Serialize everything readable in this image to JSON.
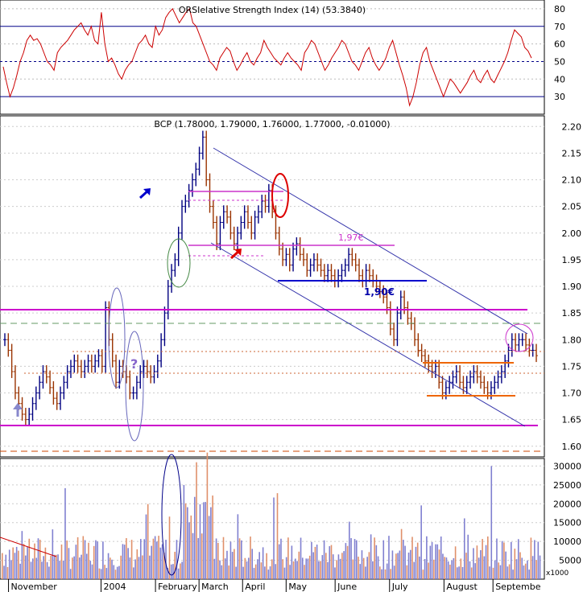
{
  "rsi_panel": {
    "title": "ORSIelative Strength Index (14) (53.3840)",
    "ylim": [
      20,
      85
    ],
    "ticks": [
      "80",
      "70",
      "60",
      "50",
      "40",
      "30"
    ],
    "tick_values": [
      80,
      70,
      60,
      50,
      40,
      30
    ],
    "line_color": "#cc0000",
    "upper_level": 70,
    "lower_level": 30,
    "mid_level": 50,
    "values": [
      47,
      38,
      30,
      35,
      42,
      50,
      55,
      62,
      65,
      62,
      63,
      60,
      55,
      50,
      48,
      45,
      55,
      58,
      60,
      62,
      65,
      68,
      70,
      72,
      68,
      65,
      70,
      62,
      60,
      78,
      60,
      50,
      52,
      48,
      43,
      40,
      45,
      48,
      50,
      55,
      60,
      62,
      65,
      60,
      58,
      70,
      65,
      68,
      75,
      78,
      80,
      76,
      72,
      75,
      78,
      80,
      72,
      70,
      65,
      60,
      55,
      50,
      48,
      45,
      52,
      55,
      58,
      56,
      50,
      45,
      48,
      52,
      55,
      50,
      48,
      52,
      55,
      62,
      58,
      55,
      52,
      50,
      48,
      52,
      55,
      52,
      50,
      48,
      45,
      55,
      58,
      62,
      60,
      55,
      50,
      45,
      48,
      52,
      55,
      58,
      62,
      60,
      55,
      50,
      48,
      45,
      50,
      55,
      58,
      52,
      48,
      45,
      48,
      52,
      58,
      62,
      55,
      48,
      42,
      35,
      25,
      30,
      38,
      48,
      55,
      58,
      50,
      45,
      40,
      35,
      30,
      35,
      40,
      38,
      35,
      32,
      35,
      38,
      42,
      45,
      40,
      38,
      42,
      45,
      40,
      38,
      42,
      46,
      50,
      55,
      62,
      68,
      66,
      64,
      58,
      56,
      52
    ]
  },
  "price_panel": {
    "title": "BCP (1.78000, 1.79000, 1.76000, 1.77000, -0.01000)",
    "ylim": [
      1.58,
      2.22
    ],
    "ticks": [
      "2.20",
      "2.15",
      "2.10",
      "2.05",
      "2.00",
      "1.95",
      "1.90",
      "1.85",
      "1.80",
      "1.75",
      "1.70",
      "1.65",
      "1.60"
    ],
    "tick_values": [
      2.2,
      2.15,
      2.1,
      2.05,
      2.0,
      1.95,
      1.9,
      1.85,
      1.8,
      1.75,
      1.7,
      1.65,
      1.6
    ],
    "up_color": "#000080",
    "down_color": "#993300",
    "annotation_197": "1,97€",
    "annotation_190": "1,90€",
    "annotation_question": "?",
    "closes": [
      1.8,
      1.78,
      1.74,
      1.7,
      1.68,
      1.66,
      1.65,
      1.66,
      1.68,
      1.7,
      1.72,
      1.74,
      1.73,
      1.71,
      1.69,
      1.68,
      1.7,
      1.72,
      1.74,
      1.75,
      1.76,
      1.75,
      1.74,
      1.75,
      1.76,
      1.75,
      1.76,
      1.77,
      1.75,
      1.86,
      1.8,
      1.76,
      1.72,
      1.75,
      1.74,
      1.73,
      1.7,
      1.7,
      1.72,
      1.74,
      1.75,
      1.74,
      1.73,
      1.74,
      1.76,
      1.8,
      1.85,
      1.9,
      1.93,
      1.95,
      2.0,
      2.05,
      2.06,
      2.08,
      2.1,
      2.12,
      2.15,
      2.18,
      2.1,
      2.05,
      2.02,
      1.98,
      2.02,
      2.04,
      2.03,
      2.0,
      1.98,
      2.0,
      2.02,
      2.04,
      2.02,
      2.0,
      2.03,
      2.04,
      2.06,
      2.05,
      2.08,
      2.04,
      2.0,
      1.97,
      1.95,
      1.96,
      1.94,
      1.97,
      1.98,
      1.96,
      1.95,
      1.93,
      1.94,
      1.95,
      1.94,
      1.93,
      1.92,
      1.93,
      1.92,
      1.91,
      1.92,
      1.93,
      1.94,
      1.96,
      1.95,
      1.94,
      1.92,
      1.91,
      1.93,
      1.92,
      1.91,
      1.9,
      1.89,
      1.88,
      1.86,
      1.82,
      1.8,
      1.85,
      1.88,
      1.86,
      1.84,
      1.83,
      1.8,
      1.78,
      1.77,
      1.76,
      1.75,
      1.74,
      1.75,
      1.72,
      1.7,
      1.71,
      1.72,
      1.73,
      1.74,
      1.72,
      1.71,
      1.72,
      1.73,
      1.74,
      1.73,
      1.72,
      1.71,
      1.7,
      1.71,
      1.72,
      1.73,
      1.74,
      1.76,
      1.78,
      1.8,
      1.79,
      1.8,
      1.8,
      1.79,
      1.78,
      1.78,
      1.77
    ]
  },
  "volume_panel": {
    "ylim": [
      0,
      32000
    ],
    "ticks": [
      "30000",
      "25000",
      "20000",
      "15000",
      "10000",
      "5000"
    ],
    "tick_values": [
      30000,
      25000,
      20000,
      15000,
      10000,
      5000
    ],
    "multiplier_label": "x1000",
    "bar_color_a": "#8080d0",
    "bar_color_b": "#e0906a"
  },
  "x_axis": {
    "labels": [
      "November",
      "2004",
      "February",
      "March",
      "April",
      "May",
      "June",
      "July",
      "August",
      "Septembe"
    ],
    "label_x_frac": [
      0.06,
      0.23,
      0.33,
      0.41,
      0.49,
      0.57,
      0.66,
      0.76,
      0.86,
      0.95
    ]
  },
  "chart_data": [
    {
      "type": "line",
      "title": "ORSIelative Strength Index (14) (53.3840)",
      "ylim": [
        20,
        85
      ],
      "series": [
        {
          "name": "RSI",
          "values": "see rsi_panel.values"
        }
      ]
    },
    {
      "type": "bar",
      "title": "BCP (1.78000, 1.79000, 1.76000, 1.77000, -0.01000)",
      "ylim": [
        1.58,
        2.22
      ],
      "categories": [
        "November",
        "2004",
        "February",
        "March",
        "April",
        "May",
        "June",
        "July",
        "August",
        "Septembe"
      ]
    },
    {
      "type": "bar",
      "ylim": [
        0,
        32000
      ],
      "ylabel": "x1000"
    }
  ]
}
